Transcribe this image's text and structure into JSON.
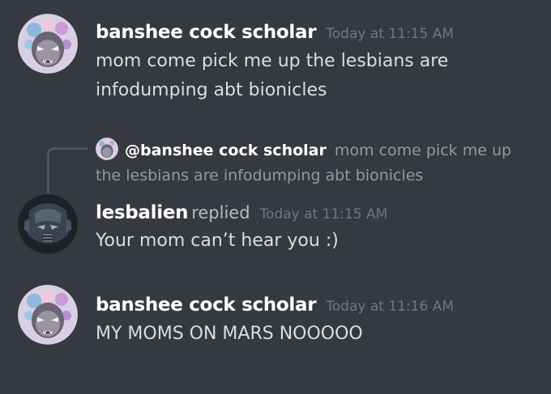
{
  "messages": [
    {
      "username": "banshee cock scholar",
      "timestamp": "Today at 11:15 AM",
      "lines": [
        "mom come pick me up the lesbians are",
        "infodumping abt bionicles"
      ],
      "avatar_icon": "fairy-avatar-icon"
    },
    {
      "reply": {
        "mention": "@banshee cock scholar",
        "preview_line1": "mom come pick me up",
        "preview_line2": "the lesbians are infodumping abt bionicles"
      },
      "username": "lesbalien",
      "replied_label": "replied",
      "timestamp": "Today at 11:15 AM",
      "lines": [
        "Your mom can’t hear you :)"
      ],
      "avatar_icon": "robot-avatar-icon"
    },
    {
      "username": "banshee cock scholar",
      "timestamp": "Today at 11:16 AM",
      "lines": [
        "MY MOMS ON MARS NOOOOO"
      ],
      "avatar_icon": "fairy-avatar-icon"
    }
  ],
  "colors": {
    "background": "#36393f",
    "username": "#ffffff",
    "message_text": "#dcddde",
    "timestamp": "#72767d",
    "reply_preview": "#96989d"
  }
}
